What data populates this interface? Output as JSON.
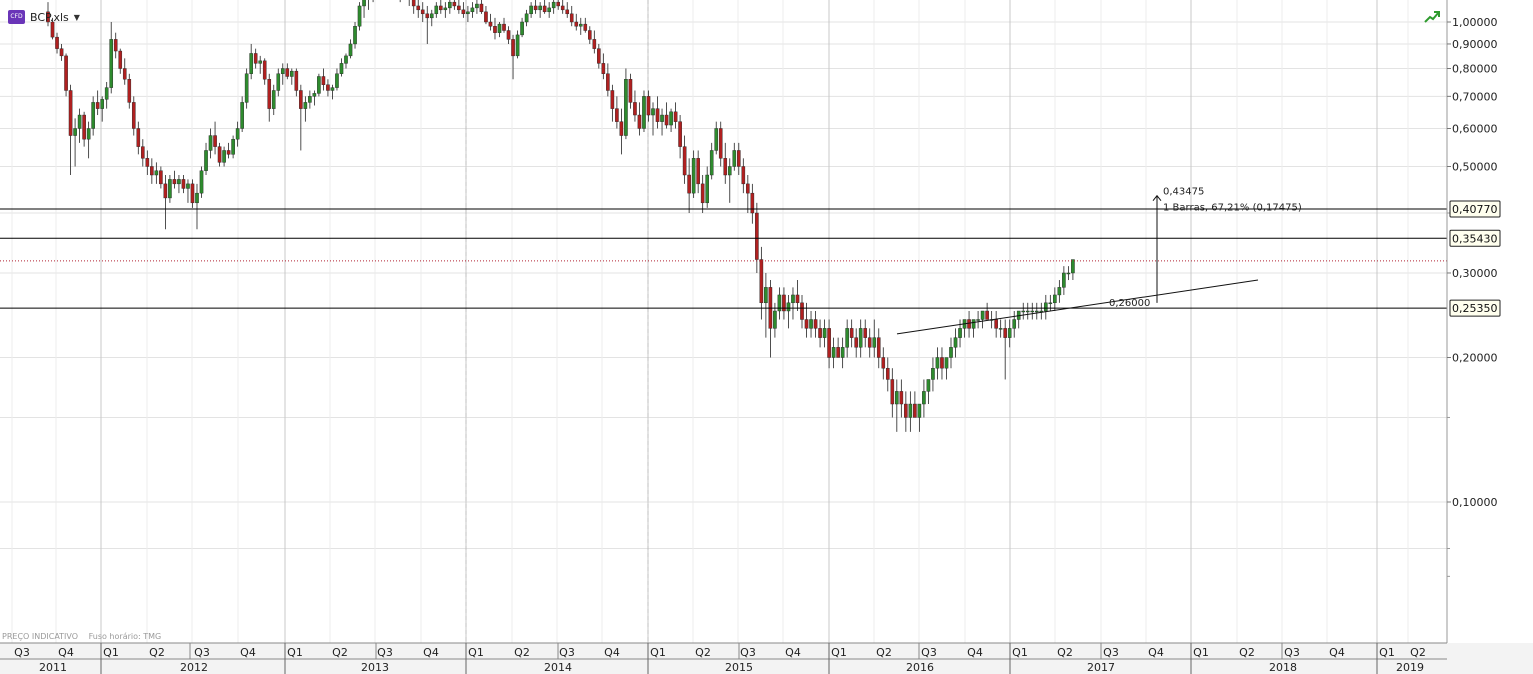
{
  "instrument": {
    "badge": "CFD",
    "symbol": "BCP.xls"
  },
  "footer": {
    "price_note": "PREÇO INDICATIVO",
    "timezone_note": "Fuso horário: TMG"
  },
  "colors": {
    "up_candle": "#2e8b2e",
    "down_candle": "#b02020",
    "wick": "#222222",
    "grid": "#e3e3e3",
    "current_price_line": "#b02030",
    "level_line": "#000000",
    "label_bg": "#ffffee"
  },
  "chart_data": {
    "type": "candlestick",
    "scale": "log",
    "timeframe": "weekly",
    "ylim": [
      0.07,
      1.05
    ],
    "y_ticks": [
      "1,00000",
      "0,90000",
      "0,80000",
      "0,70000",
      "0,60000",
      "0,50000",
      "0,30000",
      "0,20000",
      "0,10000"
    ],
    "y_tick_values": [
      1.0,
      0.9,
      0.8,
      0.7,
      0.6,
      0.5,
      0.3,
      0.2,
      0.1
    ],
    "x_quarters": [
      "Q3",
      "Q4",
      "Q1",
      "Q2",
      "Q3",
      "Q4",
      "Q1",
      "Q2",
      "Q3",
      "Q4",
      "Q1",
      "Q2",
      "Q3",
      "Q4",
      "Q1",
      "Q2",
      "Q3",
      "Q4",
      "Q1",
      "Q2",
      "Q3",
      "Q4",
      "Q1",
      "Q2",
      "Q3",
      "Q4",
      "Q1",
      "Q2",
      "Q3",
      "Q4",
      "Q1",
      "Q2"
    ],
    "x_years": [
      "2011",
      "2012",
      "2013",
      "2014",
      "2015",
      "2016",
      "2017",
      "2018",
      "2019"
    ],
    "horizontal_levels": [
      {
        "label": "0,40770",
        "value": 0.4077
      },
      {
        "label": "0,35430",
        "value": 0.3543
      },
      {
        "label": "0,25350",
        "value": 0.2535
      }
    ],
    "current_price": 0.318,
    "trendline": {
      "start_value": 0.224,
      "end_value": 0.29,
      "label": "0,26000"
    },
    "measure": {
      "target_label": "0,43475",
      "info": "1 Barras, 67,21% (0,17475)",
      "from_value": 0.26,
      "to_value": 0.43475
    },
    "candles": [
      [
        1.05,
        1.1,
        0.98,
        1.0
      ],
      [
        1.0,
        1.02,
        0.92,
        0.93
      ],
      [
        0.93,
        0.95,
        0.86,
        0.88
      ],
      [
        0.88,
        0.9,
        0.83,
        0.85
      ],
      [
        0.85,
        0.86,
        0.7,
        0.72
      ],
      [
        0.72,
        0.74,
        0.48,
        0.58
      ],
      [
        0.58,
        0.63,
        0.5,
        0.6
      ],
      [
        0.6,
        0.66,
        0.56,
        0.64
      ],
      [
        0.64,
        0.65,
        0.55,
        0.57
      ],
      [
        0.57,
        0.62,
        0.52,
        0.6
      ],
      [
        0.6,
        0.7,
        0.58,
        0.68
      ],
      [
        0.68,
        0.72,
        0.64,
        0.66
      ],
      [
        0.66,
        0.7,
        0.62,
        0.69
      ],
      [
        0.69,
        0.75,
        0.66,
        0.73
      ],
      [
        0.73,
        1.0,
        0.71,
        0.92
      ],
      [
        0.92,
        0.95,
        0.84,
        0.87
      ],
      [
        0.87,
        0.88,
        0.78,
        0.8
      ],
      [
        0.8,
        0.84,
        0.74,
        0.76
      ],
      [
        0.76,
        0.78,
        0.66,
        0.68
      ],
      [
        0.68,
        0.7,
        0.58,
        0.6
      ],
      [
        0.6,
        0.62,
        0.53,
        0.55
      ],
      [
        0.55,
        0.57,
        0.5,
        0.52
      ],
      [
        0.52,
        0.54,
        0.48,
        0.5
      ],
      [
        0.5,
        0.52,
        0.46,
        0.48
      ],
      [
        0.48,
        0.51,
        0.46,
        0.49
      ],
      [
        0.49,
        0.5,
        0.45,
        0.46
      ],
      [
        0.46,
        0.48,
        0.37,
        0.43
      ],
      [
        0.43,
        0.48,
        0.42,
        0.47
      ],
      [
        0.47,
        0.49,
        0.45,
        0.46
      ],
      [
        0.46,
        0.48,
        0.44,
        0.47
      ],
      [
        0.47,
        0.48,
        0.44,
        0.45
      ],
      [
        0.45,
        0.47,
        0.42,
        0.46
      ],
      [
        0.46,
        0.47,
        0.41,
        0.42
      ],
      [
        0.42,
        0.46,
        0.37,
        0.44
      ],
      [
        0.44,
        0.5,
        0.43,
        0.49
      ],
      [
        0.49,
        0.56,
        0.48,
        0.54
      ],
      [
        0.54,
        0.6,
        0.52,
        0.58
      ],
      [
        0.58,
        0.62,
        0.53,
        0.55
      ],
      [
        0.55,
        0.56,
        0.5,
        0.51
      ],
      [
        0.51,
        0.55,
        0.5,
        0.54
      ],
      [
        0.54,
        0.56,
        0.52,
        0.53
      ],
      [
        0.53,
        0.58,
        0.52,
        0.57
      ],
      [
        0.57,
        0.62,
        0.55,
        0.6
      ],
      [
        0.6,
        0.7,
        0.59,
        0.68
      ],
      [
        0.68,
        0.8,
        0.66,
        0.78
      ],
      [
        0.78,
        0.9,
        0.76,
        0.86
      ],
      [
        0.86,
        0.88,
        0.8,
        0.82
      ],
      [
        0.82,
        0.85,
        0.78,
        0.83
      ],
      [
        0.83,
        0.84,
        0.74,
        0.76
      ],
      [
        0.76,
        0.78,
        0.62,
        0.66
      ],
      [
        0.66,
        0.74,
        0.64,
        0.72
      ],
      [
        0.72,
        0.8,
        0.7,
        0.78
      ],
      [
        0.78,
        0.82,
        0.74,
        0.8
      ],
      [
        0.8,
        0.82,
        0.76,
        0.77
      ],
      [
        0.77,
        0.8,
        0.74,
        0.79
      ],
      [
        0.79,
        0.8,
        0.7,
        0.72
      ],
      [
        0.72,
        0.74,
        0.54,
        0.66
      ],
      [
        0.66,
        0.7,
        0.62,
        0.68
      ],
      [
        0.68,
        0.72,
        0.66,
        0.7
      ],
      [
        0.7,
        0.72,
        0.67,
        0.71
      ],
      [
        0.71,
        0.78,
        0.7,
        0.77
      ],
      [
        0.77,
        0.8,
        0.72,
        0.74
      ],
      [
        0.74,
        0.76,
        0.7,
        0.72
      ],
      [
        0.72,
        0.74,
        0.69,
        0.73
      ],
      [
        0.73,
        0.8,
        0.72,
        0.78
      ],
      [
        0.78,
        0.84,
        0.77,
        0.82
      ],
      [
        0.82,
        0.86,
        0.8,
        0.85
      ],
      [
        0.85,
        0.92,
        0.84,
        0.9
      ],
      [
        0.9,
        1.0,
        0.88,
        0.98
      ],
      [
        0.98,
        1.1,
        0.96,
        1.08
      ],
      [
        1.08,
        1.15,
        1.02,
        1.12
      ],
      [
        1.12,
        1.18,
        1.06,
        1.14
      ],
      [
        1.14,
        1.2,
        1.1,
        1.16
      ],
      [
        1.16,
        1.22,
        1.12,
        1.18
      ],
      [
        1.18,
        1.24,
        1.14,
        1.2
      ],
      [
        1.2,
        1.25,
        1.15,
        1.22
      ],
      [
        1.22,
        1.26,
        1.16,
        1.18
      ],
      [
        1.18,
        1.22,
        1.12,
        1.15
      ],
      [
        1.15,
        1.2,
        1.1,
        1.17
      ],
      [
        1.17,
        1.22,
        1.12,
        1.14
      ],
      [
        1.14,
        1.18,
        1.08,
        1.12
      ],
      [
        1.12,
        1.16,
        1.04,
        1.08
      ],
      [
        1.08,
        1.12,
        1.02,
        1.06
      ],
      [
        1.06,
        1.1,
        1.0,
        1.04
      ],
      [
        1.04,
        1.08,
        0.9,
        1.02
      ],
      [
        1.02,
        1.06,
        0.98,
        1.04
      ],
      [
        1.04,
        1.1,
        1.02,
        1.08
      ],
      [
        1.08,
        1.12,
        1.04,
        1.06
      ],
      [
        1.06,
        1.1,
        1.02,
        1.07
      ],
      [
        1.07,
        1.12,
        1.04,
        1.1
      ],
      [
        1.1,
        1.14,
        1.06,
        1.08
      ],
      [
        1.08,
        1.12,
        1.04,
        1.06
      ],
      [
        1.06,
        1.1,
        1.02,
        1.04
      ],
      [
        1.04,
        1.08,
        1.0,
        1.05
      ],
      [
        1.05,
        1.1,
        1.02,
        1.07
      ],
      [
        1.07,
        1.12,
        1.04,
        1.09
      ],
      [
        1.09,
        1.12,
        1.04,
        1.05
      ],
      [
        1.05,
        1.08,
        0.99,
        1.0
      ],
      [
        1.0,
        1.04,
        0.96,
        0.98
      ],
      [
        0.98,
        1.02,
        0.92,
        0.95
      ],
      [
        0.95,
        1.0,
        0.93,
        0.99
      ],
      [
        0.99,
        1.02,
        0.95,
        0.96
      ],
      [
        0.96,
        0.98,
        0.9,
        0.92
      ],
      [
        0.92,
        0.94,
        0.76,
        0.85
      ],
      [
        0.85,
        0.96,
        0.84,
        0.94
      ],
      [
        0.94,
        1.02,
        0.93,
        1.0
      ],
      [
        1.0,
        1.06,
        0.98,
        1.04
      ],
      [
        1.04,
        1.1,
        1.02,
        1.08
      ],
      [
        1.08,
        1.12,
        1.04,
        1.06
      ],
      [
        1.06,
        1.1,
        1.02,
        1.08
      ],
      [
        1.08,
        1.12,
        1.04,
        1.05
      ],
      [
        1.05,
        1.1,
        1.02,
        1.07
      ],
      [
        1.07,
        1.12,
        1.04,
        1.1
      ],
      [
        1.1,
        1.14,
        1.06,
        1.08
      ],
      [
        1.08,
        1.12,
        1.04,
        1.06
      ],
      [
        1.06,
        1.1,
        1.02,
        1.04
      ],
      [
        1.04,
        1.08,
        0.98,
        1.0
      ],
      [
        1.0,
        1.04,
        0.96,
        0.98
      ],
      [
        0.98,
        1.02,
        0.94,
        0.99
      ],
      [
        0.99,
        1.02,
        0.95,
        0.96
      ],
      [
        0.96,
        0.98,
        0.9,
        0.92
      ],
      [
        0.92,
        0.96,
        0.86,
        0.88
      ],
      [
        0.88,
        0.9,
        0.8,
        0.82
      ],
      [
        0.82,
        0.86,
        0.76,
        0.78
      ],
      [
        0.78,
        0.82,
        0.7,
        0.72
      ],
      [
        0.72,
        0.74,
        0.62,
        0.66
      ],
      [
        0.66,
        0.7,
        0.6,
        0.62
      ],
      [
        0.62,
        0.66,
        0.53,
        0.58
      ],
      [
        0.58,
        0.8,
        0.57,
        0.76
      ],
      [
        0.76,
        0.78,
        0.66,
        0.68
      ],
      [
        0.68,
        0.72,
        0.62,
        0.64
      ],
      [
        0.64,
        0.68,
        0.58,
        0.6
      ],
      [
        0.6,
        0.72,
        0.59,
        0.7
      ],
      [
        0.7,
        0.72,
        0.62,
        0.64
      ],
      [
        0.64,
        0.68,
        0.58,
        0.66
      ],
      [
        0.66,
        0.7,
        0.6,
        0.62
      ],
      [
        0.62,
        0.66,
        0.58,
        0.64
      ],
      [
        0.64,
        0.68,
        0.6,
        0.61
      ],
      [
        0.61,
        0.66,
        0.59,
        0.65
      ],
      [
        0.65,
        0.68,
        0.6,
        0.62
      ],
      [
        0.62,
        0.64,
        0.52,
        0.55
      ],
      [
        0.55,
        0.58,
        0.46,
        0.48
      ],
      [
        0.48,
        0.52,
        0.4,
        0.44
      ],
      [
        0.44,
        0.54,
        0.43,
        0.52
      ],
      [
        0.52,
        0.54,
        0.44,
        0.46
      ],
      [
        0.46,
        0.48,
        0.4,
        0.42
      ],
      [
        0.42,
        0.5,
        0.41,
        0.48
      ],
      [
        0.48,
        0.56,
        0.47,
        0.54
      ],
      [
        0.54,
        0.62,
        0.53,
        0.6
      ],
      [
        0.6,
        0.62,
        0.5,
        0.52
      ],
      [
        0.52,
        0.56,
        0.46,
        0.48
      ],
      [
        0.48,
        0.52,
        0.42,
        0.5
      ],
      [
        0.5,
        0.56,
        0.49,
        0.54
      ],
      [
        0.54,
        0.56,
        0.48,
        0.5
      ],
      [
        0.5,
        0.52,
        0.44,
        0.46
      ],
      [
        0.46,
        0.48,
        0.4,
        0.44
      ],
      [
        0.44,
        0.46,
        0.38,
        0.4
      ],
      [
        0.4,
        0.42,
        0.3,
        0.32
      ],
      [
        0.32,
        0.34,
        0.24,
        0.26
      ],
      [
        0.26,
        0.3,
        0.22,
        0.28
      ],
      [
        0.28,
        0.29,
        0.2,
        0.23
      ],
      [
        0.23,
        0.26,
        0.22,
        0.25
      ],
      [
        0.25,
        0.28,
        0.24,
        0.27
      ],
      [
        0.27,
        0.28,
        0.24,
        0.25
      ],
      [
        0.25,
        0.27,
        0.23,
        0.26
      ],
      [
        0.26,
        0.28,
        0.24,
        0.27
      ],
      [
        0.27,
        0.29,
        0.25,
        0.26
      ],
      [
        0.26,
        0.27,
        0.23,
        0.24
      ],
      [
        0.24,
        0.26,
        0.22,
        0.23
      ],
      [
        0.23,
        0.25,
        0.22,
        0.24
      ],
      [
        0.24,
        0.25,
        0.22,
        0.23
      ],
      [
        0.23,
        0.24,
        0.21,
        0.22
      ],
      [
        0.22,
        0.24,
        0.21,
        0.23
      ],
      [
        0.23,
        0.24,
        0.19,
        0.2
      ],
      [
        0.2,
        0.22,
        0.19,
        0.21
      ],
      [
        0.21,
        0.22,
        0.2,
        0.2
      ],
      [
        0.2,
        0.22,
        0.19,
        0.21
      ],
      [
        0.21,
        0.24,
        0.2,
        0.23
      ],
      [
        0.23,
        0.24,
        0.21,
        0.22
      ],
      [
        0.22,
        0.23,
        0.2,
        0.21
      ],
      [
        0.21,
        0.24,
        0.2,
        0.23
      ],
      [
        0.23,
        0.24,
        0.21,
        0.22
      ],
      [
        0.22,
        0.23,
        0.2,
        0.21
      ],
      [
        0.21,
        0.24,
        0.2,
        0.22
      ],
      [
        0.22,
        0.23,
        0.19,
        0.2
      ],
      [
        0.2,
        0.21,
        0.18,
        0.19
      ],
      [
        0.19,
        0.2,
        0.17,
        0.18
      ],
      [
        0.18,
        0.19,
        0.15,
        0.16
      ],
      [
        0.16,
        0.18,
        0.14,
        0.17
      ],
      [
        0.17,
        0.18,
        0.15,
        0.16
      ],
      [
        0.16,
        0.17,
        0.14,
        0.15
      ],
      [
        0.15,
        0.17,
        0.14,
        0.16
      ],
      [
        0.16,
        0.17,
        0.15,
        0.15
      ],
      [
        0.15,
        0.16,
        0.14,
        0.16
      ],
      [
        0.16,
        0.18,
        0.15,
        0.17
      ],
      [
        0.17,
        0.18,
        0.16,
        0.18
      ],
      [
        0.18,
        0.2,
        0.17,
        0.19
      ],
      [
        0.19,
        0.21,
        0.18,
        0.2
      ],
      [
        0.2,
        0.21,
        0.18,
        0.19
      ],
      [
        0.19,
        0.2,
        0.18,
        0.2
      ],
      [
        0.2,
        0.22,
        0.19,
        0.21
      ],
      [
        0.21,
        0.23,
        0.2,
        0.22
      ],
      [
        0.22,
        0.24,
        0.21,
        0.23
      ],
      [
        0.23,
        0.24,
        0.22,
        0.24
      ],
      [
        0.24,
        0.25,
        0.22,
        0.23
      ],
      [
        0.23,
        0.24,
        0.22,
        0.24
      ],
      [
        0.24,
        0.25,
        0.23,
        0.24
      ],
      [
        0.24,
        0.25,
        0.23,
        0.25
      ],
      [
        0.25,
        0.26,
        0.24,
        0.24
      ],
      [
        0.24,
        0.25,
        0.23,
        0.24
      ],
      [
        0.24,
        0.25,
        0.22,
        0.23
      ],
      [
        0.23,
        0.24,
        0.22,
        0.23
      ],
      [
        0.23,
        0.24,
        0.18,
        0.22
      ],
      [
        0.22,
        0.24,
        0.21,
        0.23
      ],
      [
        0.23,
        0.25,
        0.22,
        0.24
      ],
      [
        0.24,
        0.25,
        0.23,
        0.25
      ],
      [
        0.25,
        0.26,
        0.24,
        0.25
      ],
      [
        0.25,
        0.26,
        0.24,
        0.25
      ],
      [
        0.25,
        0.26,
        0.24,
        0.25
      ],
      [
        0.25,
        0.26,
        0.24,
        0.25
      ],
      [
        0.25,
        0.26,
        0.24,
        0.25
      ],
      [
        0.25,
        0.27,
        0.24,
        0.26
      ],
      [
        0.26,
        0.27,
        0.25,
        0.26
      ],
      [
        0.26,
        0.28,
        0.25,
        0.27
      ],
      [
        0.27,
        0.29,
        0.26,
        0.28
      ],
      [
        0.28,
        0.31,
        0.27,
        0.3
      ],
      [
        0.3,
        0.31,
        0.29,
        0.3
      ],
      [
        0.3,
        0.32,
        0.29,
        0.32
      ]
    ]
  }
}
